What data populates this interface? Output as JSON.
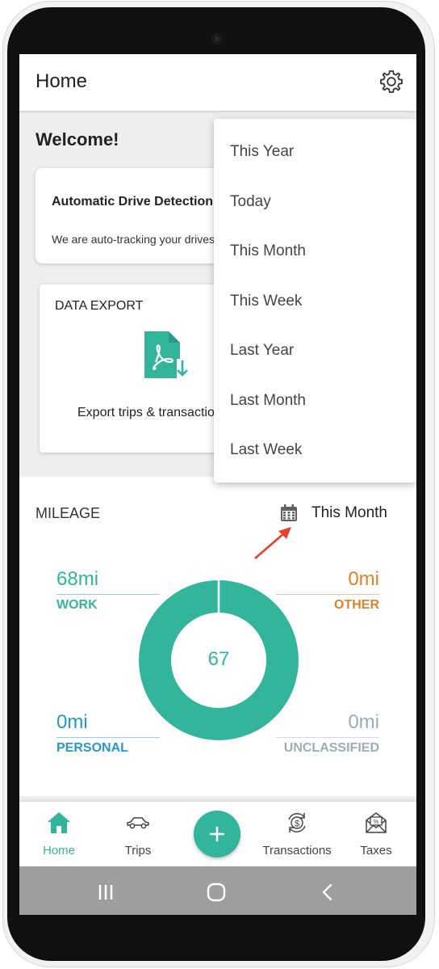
{
  "app_bar": {
    "title": "Home",
    "settings_icon": "gear-icon"
  },
  "welcome": "Welcome!",
  "drive_card": {
    "title": "Automatic Drive Detection",
    "subtitle": "We are auto-tracking your drives"
  },
  "export_card": {
    "title": "DATA EXPORT",
    "label": "Export trips & transactions",
    "icon": "pdf-download-icon"
  },
  "mileage": {
    "title": "MILEAGE",
    "period": "This Month",
    "calendar_icon": "calendar-icon",
    "total": "67",
    "stats": {
      "work": {
        "value": "68mi",
        "label": "WORK",
        "color": "#33b59c"
      },
      "other": {
        "value": "0mi",
        "label": "OTHER",
        "color": "#e0822a"
      },
      "personal": {
        "value": "0mi",
        "label": "PERSONAL",
        "color": "#2b97c2"
      },
      "unclassified": {
        "value": "0mi",
        "label": "UNCLASSIFIED",
        "color": "#a0aab5"
      }
    },
    "donut_color": "#33b59c"
  },
  "dropdown": {
    "items": [
      "This Year",
      "Today",
      "This Month",
      "This Week",
      "Last Year",
      "Last Month",
      "Last Week"
    ]
  },
  "bottom_nav": {
    "items": [
      {
        "label": "Home",
        "icon": "home-icon",
        "active": true
      },
      {
        "label": "Trips",
        "icon": "car-icon",
        "active": false
      },
      {
        "label": "Transactions",
        "icon": "dollar-cycle-icon",
        "active": false
      },
      {
        "label": "Taxes",
        "icon": "tax-envelope-icon",
        "active": false
      }
    ],
    "fab_icon": "plus-icon"
  },
  "colors": {
    "accent": "#33b59c",
    "annotation_arrow": "#e8412a"
  }
}
